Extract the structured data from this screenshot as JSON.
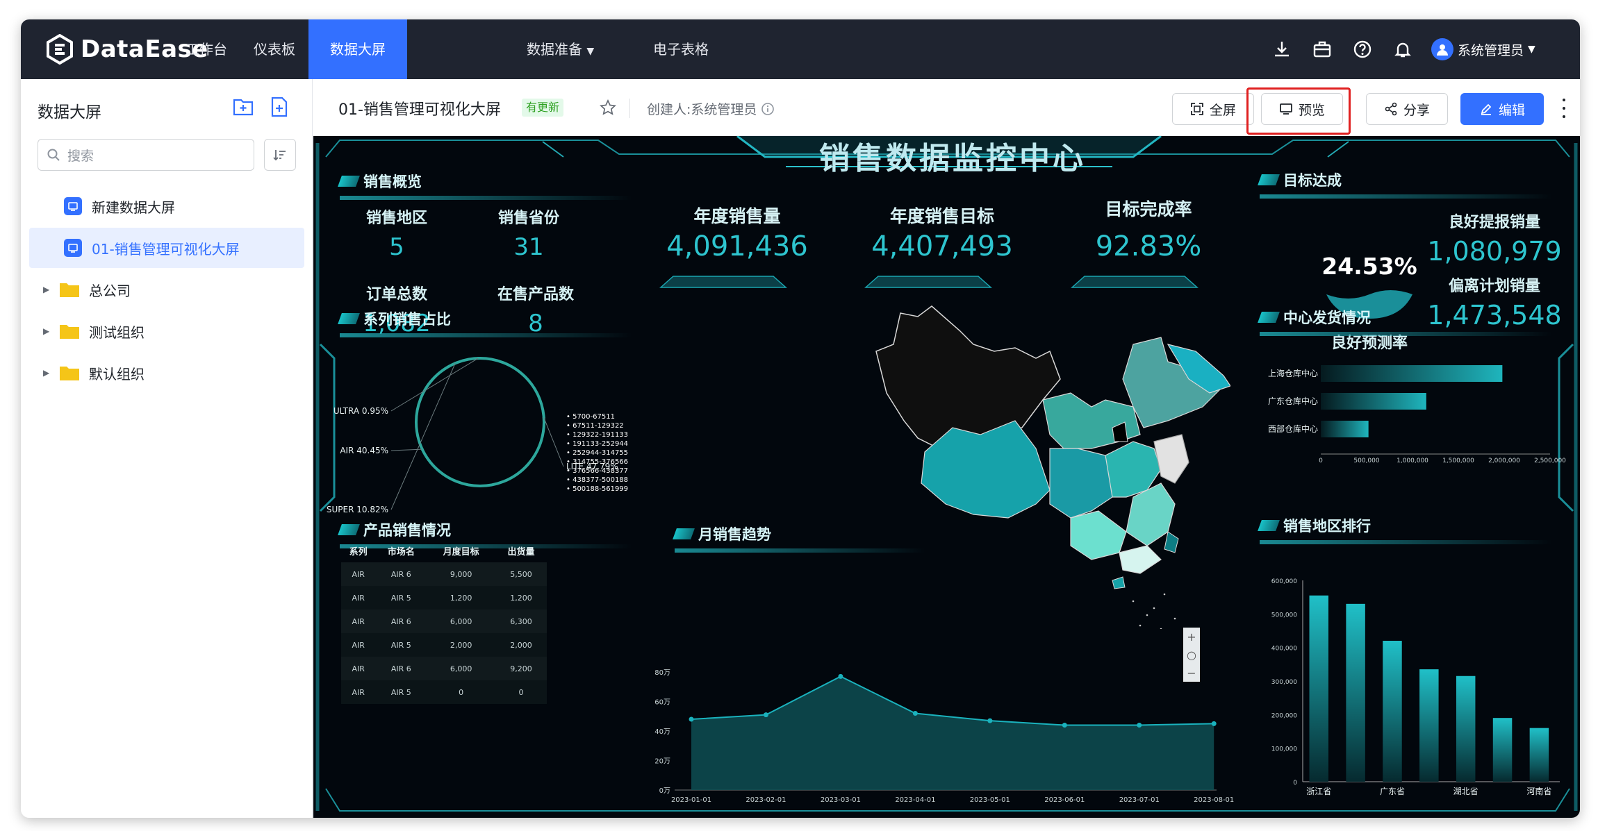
{
  "app": {
    "brand": "DataEase"
  },
  "nav": {
    "items": [
      "工作台",
      "仪表板",
      "数据大屏",
      "数据准备",
      "电子表格"
    ],
    "active": 2,
    "user": "系统管理员"
  },
  "sidebar": {
    "title": "数据大屏",
    "search_placeholder": "搜索",
    "items": [
      {
        "label": "新建数据大屏",
        "type": "screen"
      },
      {
        "label": "01-销售管理可视化大屏",
        "type": "screen",
        "selected": true
      },
      {
        "label": "总公司",
        "type": "folder"
      },
      {
        "label": "测试组织",
        "type": "folder"
      },
      {
        "label": "默认组织",
        "type": "folder"
      }
    ]
  },
  "toolbar": {
    "title": "01-销售管理可视化大屏",
    "badge": "有更新",
    "creator": "创建人:系统管理员",
    "fullscreen": "全屏",
    "preview": "预览",
    "share": "分享",
    "edit": "编辑"
  },
  "screen": {
    "title": "销售数据监控中心",
    "overview": {
      "title": "销售概览",
      "items": [
        {
          "label": "销售地区",
          "value": "5"
        },
        {
          "label": "销售省份",
          "value": "31"
        },
        {
          "label": "订单总数",
          "value": "1,082"
        },
        {
          "label": "在售产品数",
          "value": "8"
        }
      ]
    },
    "kpis": [
      {
        "label": "年度销售量",
        "value": "4,091,436"
      },
      {
        "label": "年度销售目标",
        "value": "4,407,493"
      },
      {
        "label": "目标完成率",
        "value": "92.83%"
      }
    ],
    "target": {
      "title": "目标达成",
      "gauge_value": "24.53%",
      "gauge_fill": 0.2453,
      "gauge_label": "良好预测率",
      "good_label": "良好提报销量",
      "good_value": "1,080,979",
      "dev_label": "偏离计划销量",
      "dev_value": "1,473,548"
    },
    "map": {
      "legend": [
        "5700-67511",
        "67511-129322",
        "129322-191133",
        "191133-252944",
        "252944-314755",
        "314755-376566",
        "376566-438377",
        "438377-500188",
        "500188-561999"
      ],
      "zoom_in": "+",
      "zoom_reset": "○",
      "zoom_out": "−"
    },
    "table": {
      "title": "产品销售情况",
      "headers": [
        "系列",
        "市场名",
        "月度目标",
        "出货量"
      ],
      "rows": [
        [
          "AIR",
          "AIR 6",
          "9,000",
          "5,500"
        ],
        [
          "AIR",
          "AIR 5",
          "1,200",
          "1,200"
        ],
        [
          "AIR",
          "AIR 6",
          "6,000",
          "6,300"
        ],
        [
          "AIR",
          "AIR 5",
          "2,000",
          "2,000"
        ],
        [
          "AIR",
          "AIR 6",
          "6,000",
          "9,200"
        ],
        [
          "AIR",
          "AIR 5",
          "0",
          "0"
        ]
      ]
    }
  },
  "chart_data": [
    {
      "type": "pie",
      "title": "系列销售占比",
      "slices": [
        {
          "label": "LITE",
          "value": 47.79,
          "text": "LITE 47.79%"
        },
        {
          "label": "AIR",
          "value": 40.45,
          "text": "AIR 40.45%"
        },
        {
          "label": "SUPER",
          "value": 10.82,
          "text": "SUPER 10.82%"
        },
        {
          "label": "ULTRA",
          "value": 0.95,
          "text": "ULTRA 0.95%"
        }
      ]
    },
    {
      "type": "bar",
      "title": "中心发货情况",
      "orientation": "horizontal",
      "categories": [
        "上海仓库中心",
        "广东仓库中心",
        "西部仓库中心"
      ],
      "values": [
        1980000,
        1150000,
        520000
      ],
      "xticks": [
        "0",
        "500,000",
        "1,000,000",
        "1,500,000",
        "2,000,000",
        "2,500,000"
      ],
      "xlim": [
        0,
        2500000
      ]
    },
    {
      "type": "area",
      "title": "月销售趋势",
      "x": [
        "2023-01-01",
        "2023-02-01",
        "2023-03-01",
        "2023-04-01",
        "2023-05-01",
        "2023-06-01",
        "2023-07-01",
        "2023-08-01"
      ],
      "values": [
        48,
        51,
        77,
        52,
        47,
        44,
        44,
        45
      ],
      "yticks": [
        "0万",
        "20万",
        "40万",
        "60万",
        "80万"
      ],
      "ylim": [
        0,
        80
      ]
    },
    {
      "type": "bar",
      "title": "销售地区排行",
      "categories": [
        "浙江省",
        "",
        "广东省",
        "",
        "湖北省",
        "",
        "河南省"
      ],
      "values": [
        555000,
        530000,
        420000,
        335000,
        315000,
        190000,
        160000
      ],
      "yticks": [
        "0",
        "100,000",
        "200,000",
        "300,000",
        "400,000",
        "500,000",
        "600,000"
      ],
      "ylim": [
        0,
        600000
      ]
    }
  ]
}
